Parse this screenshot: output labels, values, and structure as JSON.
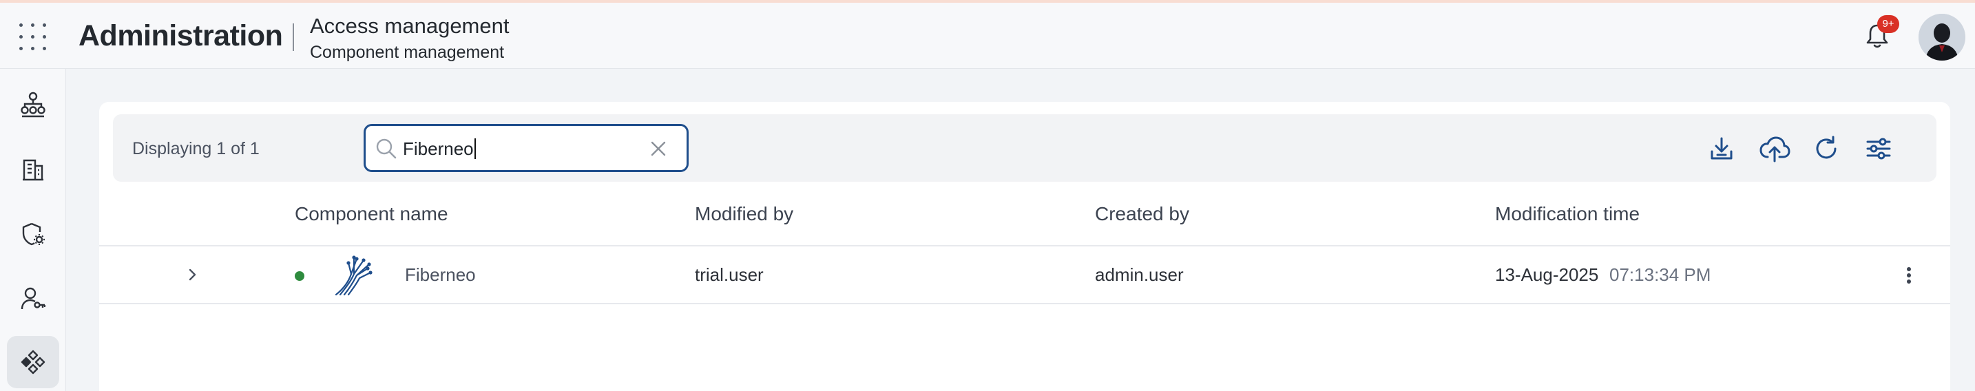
{
  "header": {
    "app_title": "Administration",
    "breadcrumb_main": "Access management",
    "breadcrumb_sub": "Component management",
    "notification_badge": "9+"
  },
  "sidebar": {
    "items": [
      {
        "icon": "hierarchy-icon",
        "active": false
      },
      {
        "icon": "building-icon",
        "active": false
      },
      {
        "icon": "shield-gear-icon",
        "active": false
      },
      {
        "icon": "user-key-icon",
        "active": false
      },
      {
        "icon": "components-icon",
        "active": true
      }
    ]
  },
  "toolbar": {
    "displaying_text": "Displaying 1 of 1",
    "search_value": "Fiberneo",
    "tools": [
      "download-icon",
      "upload-cloud-icon",
      "refresh-icon",
      "filter-settings-icon"
    ]
  },
  "table": {
    "columns": [
      "Component name",
      "Modified by",
      "Created by",
      "Modification time"
    ],
    "rows": [
      {
        "status": "active",
        "status_color": "#2e8b3e",
        "component_name": "Fiberneo",
        "modified_by": "trial.user",
        "created_by": "admin.user",
        "modified_date": "13-Aug-2025",
        "modified_time": "07:13:34 PM"
      }
    ]
  },
  "colors": {
    "accent": "#1f4e8c",
    "badge": "#d93025",
    "background": "#f2f4f7"
  }
}
